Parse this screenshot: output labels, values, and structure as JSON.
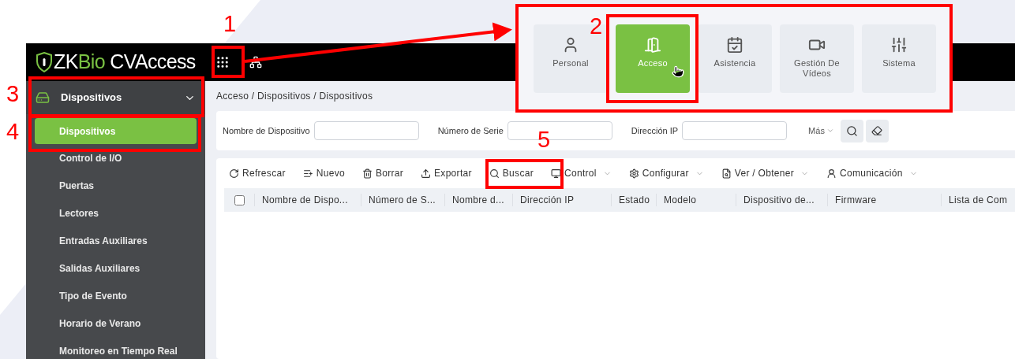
{
  "logo": [
    {
      "text": "ZK",
      "accent": false
    },
    {
      "text": "Bio",
      "accent": true
    },
    {
      "text": " CVAccess",
      "accent": false
    }
  ],
  "module_menu": [
    {
      "label": "Personal",
      "kind": "person",
      "selected": false
    },
    {
      "label": "Acceso",
      "kind": "door",
      "selected": true
    },
    {
      "label": "Asistencia",
      "kind": "calendar",
      "selected": false
    },
    {
      "label": "Gestión De Vídeos",
      "kind": "camera",
      "selected": false
    },
    {
      "label": "Sistema",
      "kind": "sliders",
      "selected": false
    }
  ],
  "sidebar": {
    "group": {
      "label": "Dispositivos",
      "expanded": true
    },
    "items": [
      {
        "label": "Dispositivos",
        "selected": true
      },
      {
        "label": "Control de I/O",
        "selected": false
      },
      {
        "label": "Puertas",
        "selected": false
      },
      {
        "label": "Lectores",
        "selected": false
      },
      {
        "label": "Entradas Auxiliares",
        "selected": false
      },
      {
        "label": "Salidas Auxiliares",
        "selected": false
      },
      {
        "label": "Tipo de Evento",
        "selected": false
      },
      {
        "label": "Horario de Verano",
        "selected": false
      },
      {
        "label": "Monitoreo en Tiempo Real",
        "selected": false
      }
    ]
  },
  "breadcrumb": "Acceso / Dispositivos / Dispositivos",
  "filters": [
    {
      "label": "Nombre de Dispositivo"
    },
    {
      "label": "Número de Serie"
    },
    {
      "label": "Dirección IP"
    }
  ],
  "more_label": "Más",
  "toolbar": [
    {
      "label": "Refrescar",
      "kind": "refresh",
      "dropdown": false
    },
    {
      "label": "Nuevo",
      "kind": "add",
      "dropdown": false
    },
    {
      "label": "Borrar",
      "kind": "delete",
      "dropdown": false
    },
    {
      "label": "Exportar",
      "kind": "export",
      "dropdown": false
    },
    {
      "label": "Buscar",
      "kind": "search",
      "dropdown": false
    },
    {
      "label": "Control",
      "kind": "monitor",
      "dropdown": true
    },
    {
      "label": "Configurar",
      "kind": "settings",
      "dropdown": true
    },
    {
      "label": "Ver / Obtener",
      "kind": "view",
      "dropdown": true
    },
    {
      "label": "Comunicación",
      "kind": "communication",
      "dropdown": true
    }
  ],
  "table": {
    "select_all_checked": false,
    "columns": [
      "Nombre de Dispo...",
      "Número de S...",
      "Nombre d...",
      "Dirección IP",
      "Estado",
      "Modelo",
      "Dispositivo de...",
      "Firmware",
      "Lista de Com"
    ]
  },
  "annotations": [
    "1",
    "2",
    "3",
    "4",
    "5"
  ]
}
